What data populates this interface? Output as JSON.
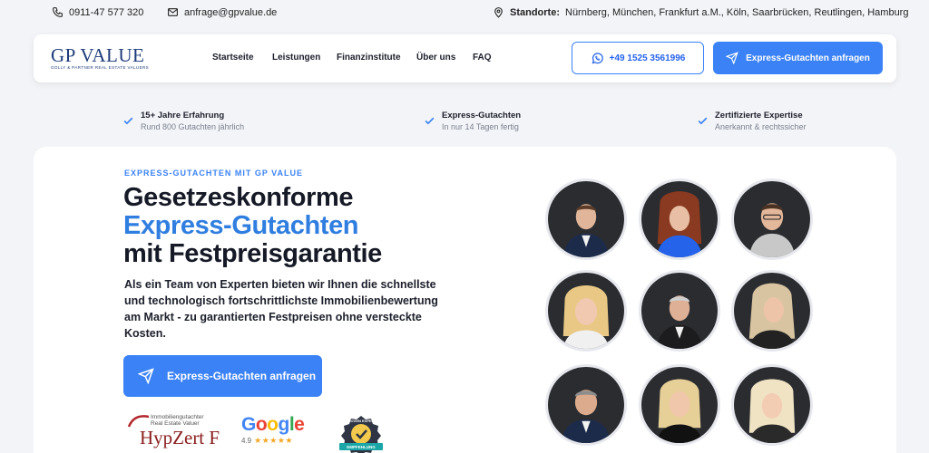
{
  "topbar": {
    "phone": "0911-47 577 320",
    "email": "anfrage@gpvalue.de",
    "locations_label": "Standorte:",
    "locations": "Nürnberg, München, Frankfurt a.M., Köln, Saarbrücken, Reutlingen, Hamburg"
  },
  "header": {
    "logo_text": "GP VALUE",
    "logo_sub": "GOLLY & PARTNER REAL ESTATE VALUERS",
    "nav": [
      "Startseite",
      "Leistungen",
      "Finanzinstitute",
      "Über uns",
      "FAQ"
    ],
    "phone_button": "+49 1525 3561996",
    "cta_button": "Express-Gutachten anfragen"
  },
  "features": [
    {
      "title": "15+ Jahre Erfahrung",
      "subtitle": "Rund 800 Gutachten jährlich"
    },
    {
      "title": "Express-Gutachten",
      "subtitle": "In nur 14 Tagen fertig"
    },
    {
      "title": "Zertifizierte Expertise",
      "subtitle": "Anerkannt & rechtssicher"
    }
  ],
  "hero": {
    "eyebrow": "EXPRESS-GUTACHTEN MIT GP VALUE",
    "headline_line1": "Gesetzeskonforme",
    "headline_line2": "Express-Gutachten",
    "headline_line3": "mit Festpreisgarantie",
    "lead": "Als ein Team von Experten bieten wir Ihnen die schnellste und technologisch fortschrittlichste Immobilienbewertung am Markt - zu garantierten Festpreisen ohne versteckte Kosten.",
    "button": "Express-Gutachten anfragen"
  },
  "badges": {
    "hypzert_small_line1": "Immobiliengutachter",
    "hypzert_small_line2": "Real Estate Valuer",
    "hypzert_name": "HypZert F",
    "google_word": "Google",
    "google_rating": "4.9",
    "google_stars": "★★★★★",
    "provenexpert_line1": "PROVEN EXPERT",
    "provenexpert_line2": "EMPFEHLUNG"
  },
  "team_count": 9,
  "colors": {
    "accent": "#3b82f6",
    "headline_blue": "#2f7ee0",
    "logo_navy": "#1d3b7a",
    "background": "#f3f4f7"
  }
}
